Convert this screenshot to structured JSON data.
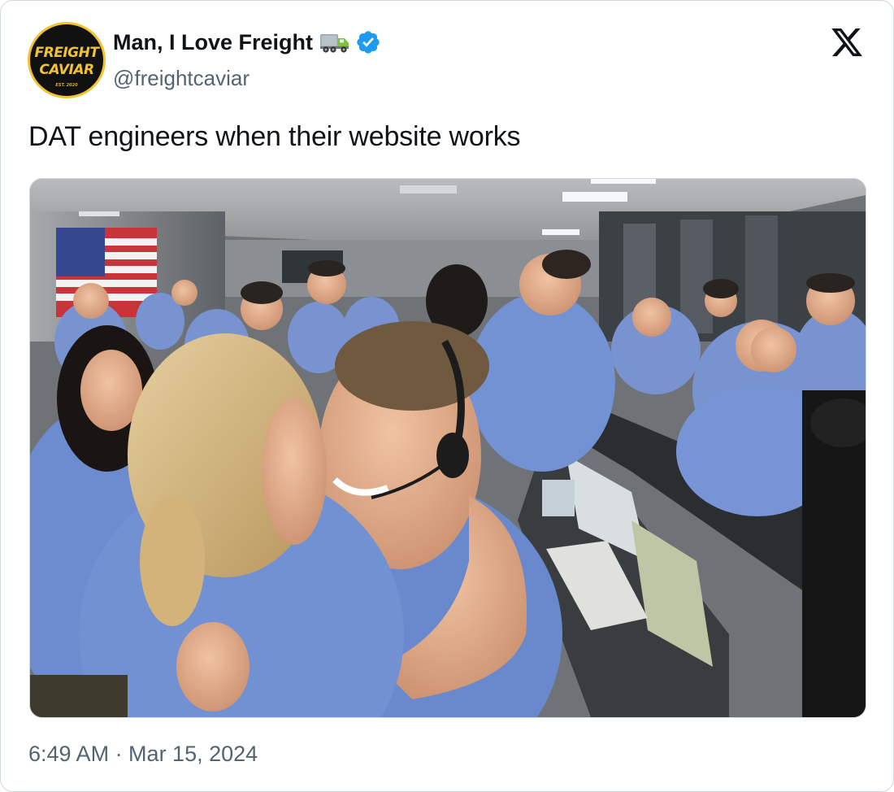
{
  "author": {
    "name": "Man, I Love Freight",
    "handle": "@freightcaviar",
    "avatar_logo": [
      "FREIGHT",
      "CAVIAR",
      "EST. 2020"
    ],
    "verified": true,
    "name_emoji_icon": "delivery-truck-emoji"
  },
  "tweet": {
    "text": "DAT engineers when their website works",
    "timestamp": "6:49 AM · Mar 15, 2024",
    "media_description": "Photo of engineers in blue polo shirts celebrating and hugging in a mission control room"
  },
  "colors": {
    "verified_blue": "#1d9bf0",
    "logo_yellow": "#f2c230",
    "secondary_text": "#536471",
    "shirt_blue": "#6f8fd4"
  },
  "icons": {
    "platform": "x-logo-icon",
    "verified": "verified-badge-icon"
  }
}
